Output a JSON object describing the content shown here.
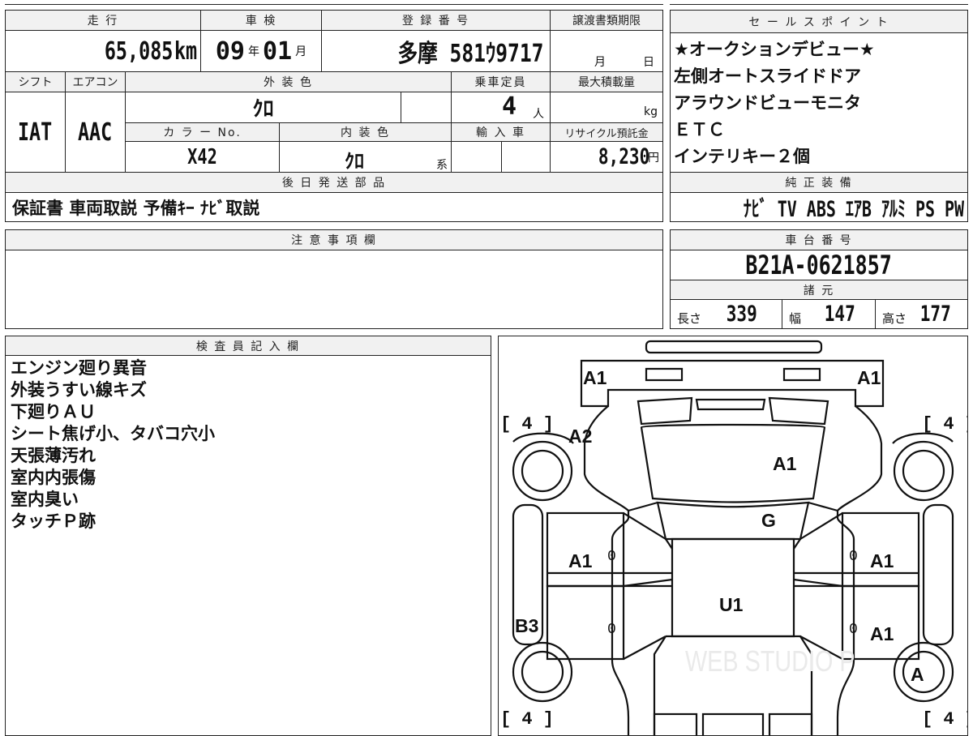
{
  "mileage": {
    "label": "走 行",
    "value": "65,085",
    "unit": "km"
  },
  "inspection": {
    "label": "車 検",
    "year": "09",
    "year_unit": "年",
    "month": "01",
    "month_unit": "月"
  },
  "registration": {
    "label": "登 録 番 号",
    "value": "多摩 581ｳ9717"
  },
  "transfer_deadline": {
    "label": "譲渡書類期限",
    "month_unit": "月",
    "day_unit": "日"
  },
  "shift": {
    "label": "シフト",
    "value": "IAT"
  },
  "aircon": {
    "label": "エアコン",
    "value": "AAC"
  },
  "exterior_color": {
    "label": "外 装 色",
    "value": "ｸﾛ"
  },
  "capacity": {
    "label": "乗車定員",
    "value": "4",
    "unit": "人"
  },
  "max_load": {
    "label": "最大積載量",
    "unit": "kg"
  },
  "color_no": {
    "label": "カ ラ ー No.",
    "value": "X42"
  },
  "interior_color": {
    "label": "内 装 色",
    "value": "ｸﾛ",
    "suffix": "系"
  },
  "import": {
    "label": "輸 入 車"
  },
  "recycle": {
    "label": "リサイクル預託金",
    "value": "8,230",
    "unit": "円"
  },
  "later_parts": {
    "label": "後 日 発 送 部 品",
    "value": "保証書 車両取説 予備ｷｰ ﾅﾋﾞ取説"
  },
  "sales_points": {
    "label": "セ ー ル ス ポ イ ン ト",
    "items": [
      "★オークションデビュー★",
      "左側オートスライドドア",
      "アラウンドビューモニタ",
      "ＥＴＣ",
      "インテリキー２個"
    ]
  },
  "genuine_equipment": {
    "label": "純 正 装 備",
    "value": "ﾅﾋﾞ TV ABS ｴｱB ｱﾙﾐ PS PW"
  },
  "notes": {
    "label": "注 意 事 項 欄",
    "value": ""
  },
  "chassis": {
    "label": "車 台 番 号",
    "value": "B21A-0621857"
  },
  "specs": {
    "label": "諸 元",
    "length_label": "長さ",
    "length": "339",
    "width_label": "幅",
    "width": "147",
    "height_label": "高さ",
    "height": "177"
  },
  "inspector": {
    "label": "検 査 員 記 入 欄",
    "lines": [
      "エンジン廻り異音",
      "外装うすい線キズ",
      "下廻りＡＵ",
      "シート焦げ小、タバコ穴小",
      "天張薄汚れ",
      "室内内張傷",
      "室内臭い",
      "タッチＰ跡"
    ]
  },
  "diagram": {
    "marks": {
      "front_left": "A1",
      "front_right": "A1",
      "hood_left": "A2",
      "hood": "A1",
      "windshield": "G",
      "left_front_door": "A1",
      "right_front_door": "A1",
      "roof": "U1",
      "left_rocker": "B3",
      "right_rear_door": "A1",
      "rear_right_wheel": "A"
    },
    "tread": [
      "4",
      "4",
      "4",
      "4"
    ],
    "zeros": [
      "0",
      "0",
      "0",
      "0"
    ],
    "watermark": "WEB STUDIO P"
  }
}
